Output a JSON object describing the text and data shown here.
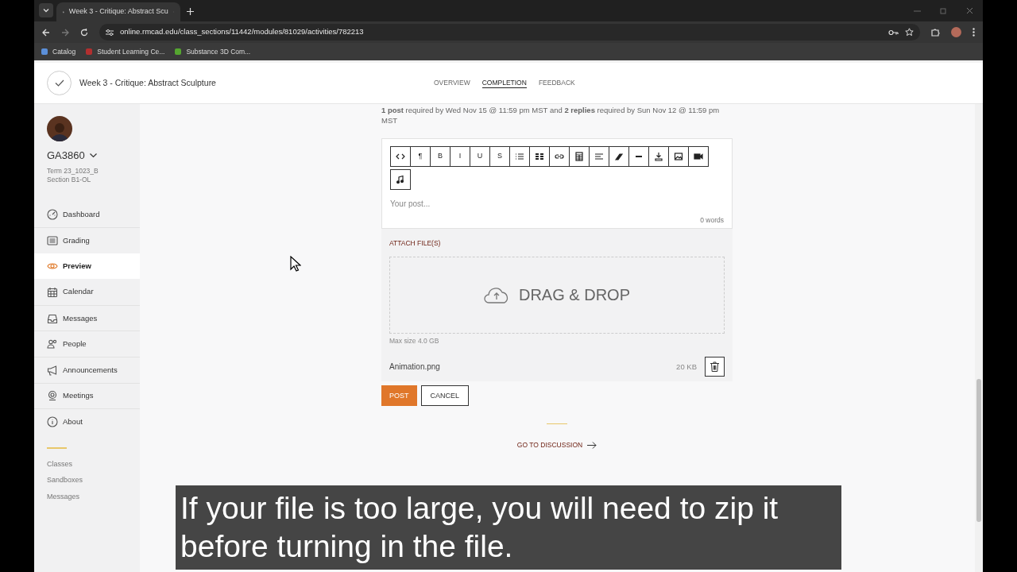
{
  "browser": {
    "tab_title": "Week 3 - Critique: Abstract Scu",
    "url": "online.rmcad.edu/class_sections/11442/modules/81029/activities/782213",
    "bookmarks": [
      "Catalog",
      "Student Learning Ce...",
      "Substance 3D Com..."
    ]
  },
  "header": {
    "title": "Week 3 - Critique: Abstract Sculpture",
    "tabs": [
      {
        "label": "OVERVIEW",
        "selected": false
      },
      {
        "label": "COMPLETION",
        "selected": true
      },
      {
        "label": "FEEDBACK",
        "selected": false
      }
    ]
  },
  "sidebar": {
    "course": "GA3860",
    "term": "Term 23_1023_B",
    "section": "Section B1-OL",
    "items": [
      {
        "label": "Dashboard",
        "selected": false
      },
      {
        "label": "Grading",
        "selected": false
      },
      {
        "label": "Preview",
        "selected": true
      },
      {
        "label": "Calendar",
        "selected": false
      },
      {
        "label": "Messages",
        "selected": false
      },
      {
        "label": "People",
        "selected": false
      },
      {
        "label": "Announcements",
        "selected": false
      },
      {
        "label": "Meetings",
        "selected": false
      },
      {
        "label": "About",
        "selected": false
      }
    ],
    "links": [
      "Classes",
      "Sandboxes",
      "Messages"
    ]
  },
  "requirement": "**1 post** required by Wed Nov 15 @ 11:59 pm MST and **2 replies** required by Sun Nov 12 @ 11:59 pm MST",
  "editor": {
    "toolbar": [
      {
        "kind": "code"
      },
      {
        "kind": "text",
        "label": "¶"
      },
      {
        "kind": "text",
        "label": "B"
      },
      {
        "kind": "text",
        "label": "I"
      },
      {
        "kind": "text",
        "label": "U"
      },
      {
        "kind": "text",
        "label": "S"
      },
      {
        "kind": "bullets"
      },
      {
        "kind": "grid"
      },
      {
        "kind": "link"
      },
      {
        "kind": "table"
      },
      {
        "kind": "align"
      },
      {
        "kind": "eraser"
      },
      {
        "kind": "rule"
      },
      {
        "kind": "download"
      },
      {
        "kind": "image"
      },
      {
        "kind": "video"
      },
      {
        "kind": "music"
      }
    ],
    "placeholder": "Your post...",
    "word_count": "0 words"
  },
  "attach": {
    "label": "ATTACH FILE(S)",
    "drop_text": "DRAG & DROP",
    "max_size": "Max size 4.0 GB",
    "file": {
      "name": "Animation.png",
      "size": "20 KB"
    }
  },
  "buttons": [
    "POST",
    "CANCEL"
  ],
  "go_to_discussion": "GO TO DISCUSSION",
  "caption": "If your file is too large, you will need to zip it before turning in the file."
}
